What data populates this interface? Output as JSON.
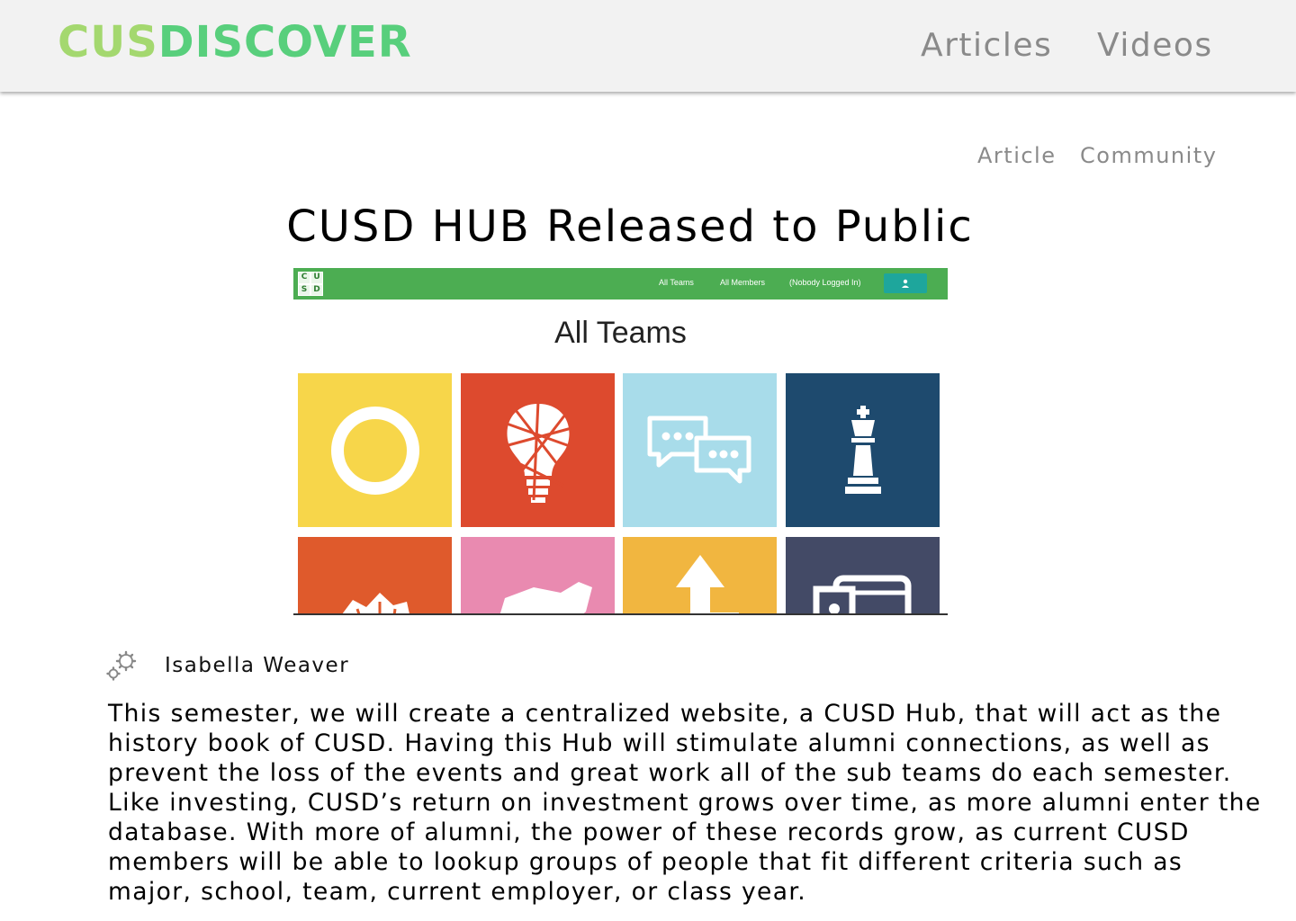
{
  "brand": {
    "part1": "CUS",
    "part2": "DISCOVER",
    "color1": "#a4d86f",
    "color2": "#58cf7c"
  },
  "top_nav": {
    "articles": "Articles",
    "videos": "Videos"
  },
  "sub_nav": {
    "article": "Article",
    "community": "Community"
  },
  "article": {
    "title": "CUSD HUB Released to Public",
    "author": "Isabella Weaver",
    "author_icon": "gear-icon",
    "body": "This semester, we will create a centralized website, a CUSD Hub, that will act as the history book of CUSD. Having this Hub will stimulate alumni connections, as well as prevent the loss of the events and great work all of the sub teams do each semester. Like investing, CUSD’s return on investment grows over time, as more alumni enter the database. With more of alumni, the power of these records grow, as current CUSD members will be able to lookup groups of people that fit different criteria such as major, school, team, current employer, or class year."
  },
  "screenshot": {
    "logo_letters": [
      "C",
      "U",
      "S",
      "D"
    ],
    "nav": [
      "All Teams",
      "All Members",
      "(Nobody Logged In)"
    ],
    "user_icon": "user-icon",
    "heading": "All Teams",
    "bar_color": "#4cad52",
    "tiles": [
      {
        "color": "#f7d64a",
        "icon": "swirl-icon"
      },
      {
        "color": "#dd4a2e",
        "icon": "lightbulb-icon"
      },
      {
        "color": "#a8dcea",
        "icon": "chat-bubbles-icon"
      },
      {
        "color": "#1e4a6e",
        "icon": "chess-king-icon"
      },
      {
        "color": "#df5a2c",
        "icon": "hand-icon"
      },
      {
        "color": "#e98ab0",
        "icon": "map-icon"
      },
      {
        "color": "#f1b640",
        "icon": "arrow-up-icon"
      },
      {
        "color": "#434a66",
        "icon": "devices-icon"
      }
    ]
  }
}
